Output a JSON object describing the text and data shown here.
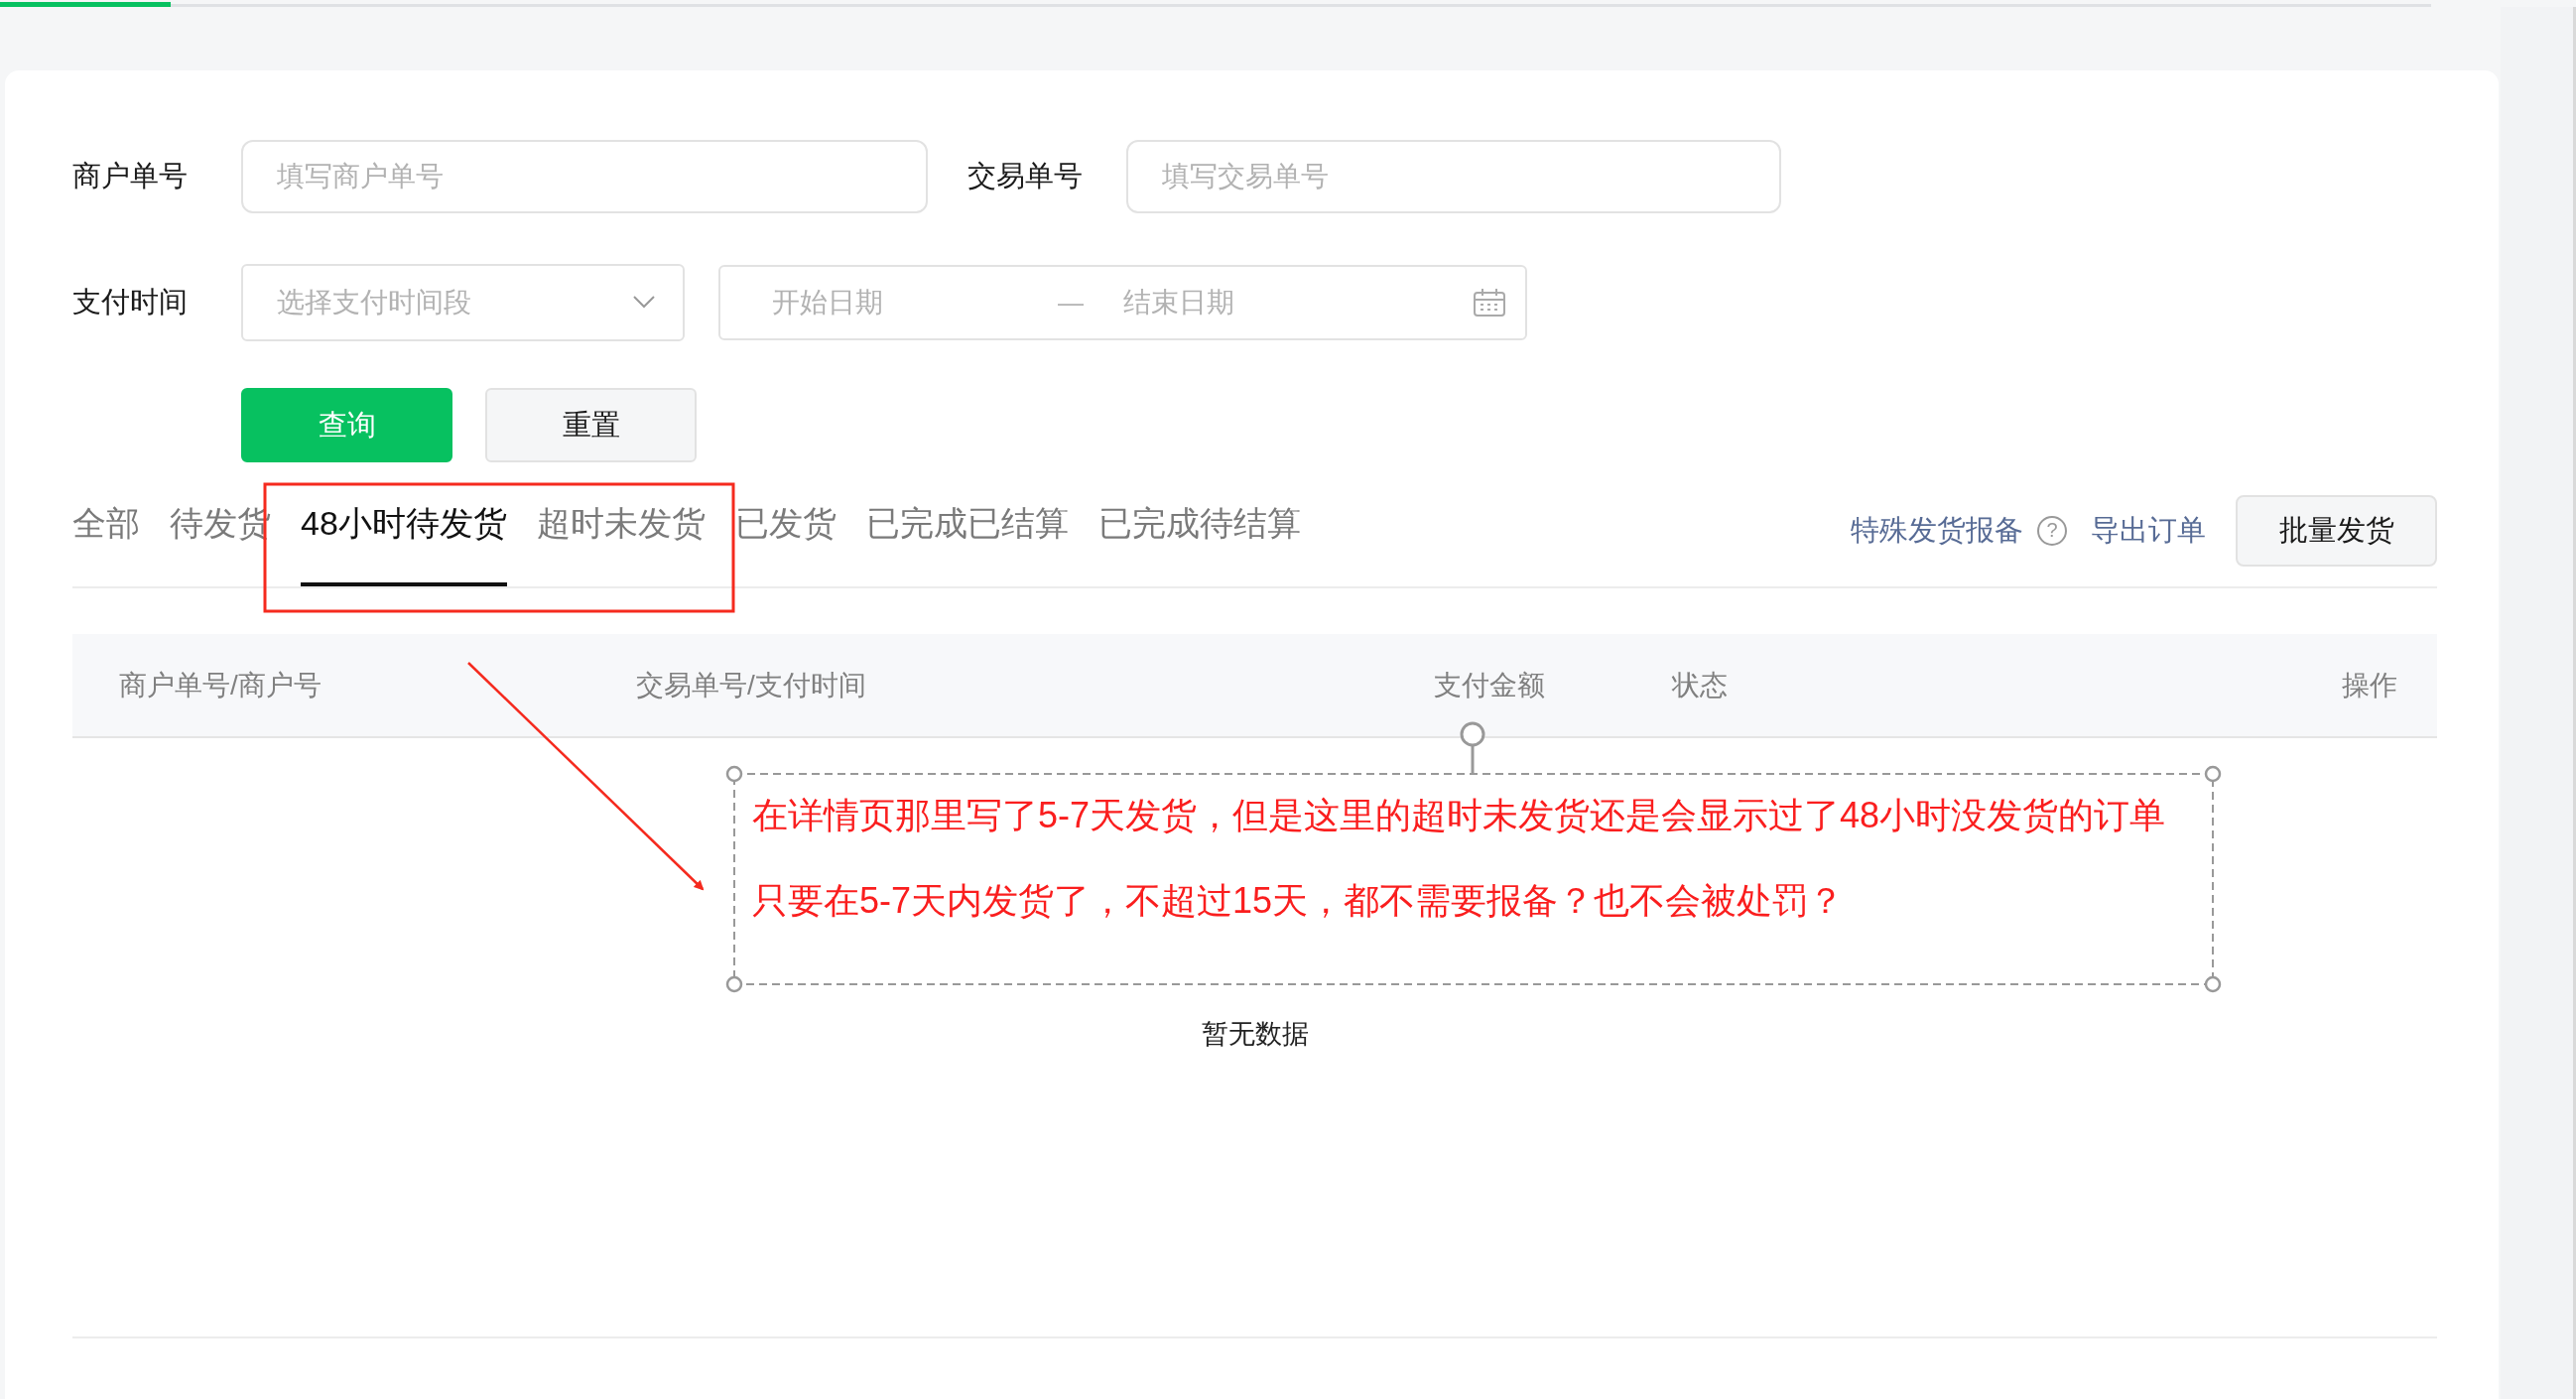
{
  "loading_bar": {
    "level": 0.07
  },
  "filters": [
    {
      "label": "商户单号",
      "placeholder": "填写商户单号"
    },
    {
      "label": "交易单号",
      "placeholder": "填写交易单号"
    }
  ],
  "pay_time": {
    "label": "支付时间",
    "select_placeholder": "选择支付时间段",
    "start_placeholder": "开始日期",
    "separator": "—",
    "end_placeholder": "结束日期"
  },
  "buttons": [
    {
      "label": "查询",
      "kind": "primary"
    },
    {
      "label": "重置",
      "kind": "default"
    }
  ],
  "tabs": [
    {
      "label": "全部",
      "selected": false
    },
    {
      "label": "待发货",
      "selected": false
    },
    {
      "label": "48小时待发货",
      "selected": true
    },
    {
      "label": "超时未发货",
      "selected": false
    },
    {
      "label": "已发货",
      "selected": false
    },
    {
      "label": "已完成已结算",
      "selected": false
    },
    {
      "label": "已完成待结算",
      "selected": false
    }
  ],
  "actions": {
    "special_link": "特殊发货报备",
    "help_glyph": "?",
    "export_link": "导出订单",
    "batch_button": "批量发货"
  },
  "table": {
    "columns": [
      "商户单号/商户号",
      "交易单号/支付时间",
      "支付金额",
      "状态",
      "操作"
    ],
    "empty_text": "暂无数据"
  },
  "annotation": {
    "lines": [
      "在详情页那里写了5-7天发货，但是这里的超时未发货还是会显示过了48小时没发货的订单",
      "只要在5-7天内发货了，不超过15天，都不需要报备？也不会被处罚？"
    ]
  }
}
